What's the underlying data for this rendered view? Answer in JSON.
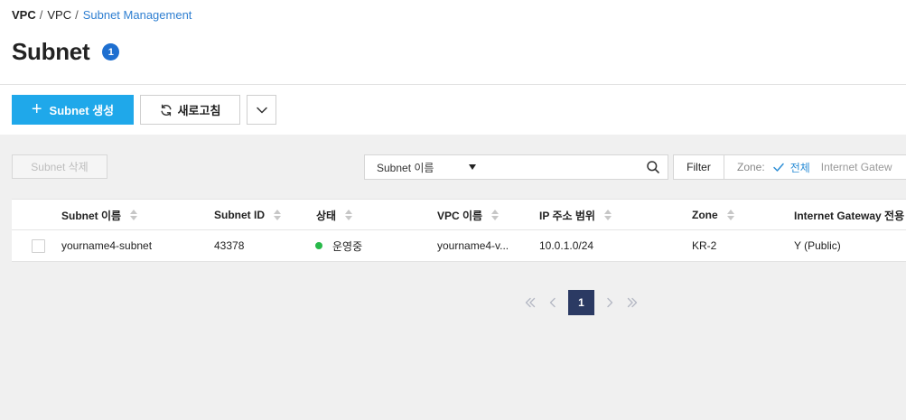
{
  "breadcrumb": {
    "items": [
      "VPC",
      "VPC",
      "Subnet Management"
    ],
    "separator": "/"
  },
  "page": {
    "title": "Subnet",
    "count": "1"
  },
  "toolbar": {
    "create_label": "Subnet 생성",
    "refresh_label": "새로고침"
  },
  "actions": {
    "delete_label": "Subnet 삭제"
  },
  "search": {
    "select_value": "Subnet 이름",
    "input_value": "",
    "filter_label": "Filter",
    "zone_label": "Zone:",
    "zone_value": "전체",
    "next_filter_label": "Internet Gatew"
  },
  "table": {
    "columns": [
      "Subnet 이름",
      "Subnet ID",
      "상태",
      "VPC 이름",
      "IP 주소 범위",
      "Zone",
      "Internet Gateway 전용"
    ],
    "rows": [
      {
        "name": "yourname4-subnet",
        "id": "43378",
        "status": "운영중",
        "vpc": "yourname4-v...",
        "ip_range": "10.0.1.0/24",
        "zone": "KR-2",
        "igw": "Y (Public)"
      }
    ]
  },
  "pagination": {
    "current_page": "1"
  },
  "colors": {
    "primary": "#1fa8ea",
    "badge": "#1e6fd0",
    "status_running": "#28b94a",
    "page_active": "#2b3a63",
    "link": "#2f7fd1"
  }
}
